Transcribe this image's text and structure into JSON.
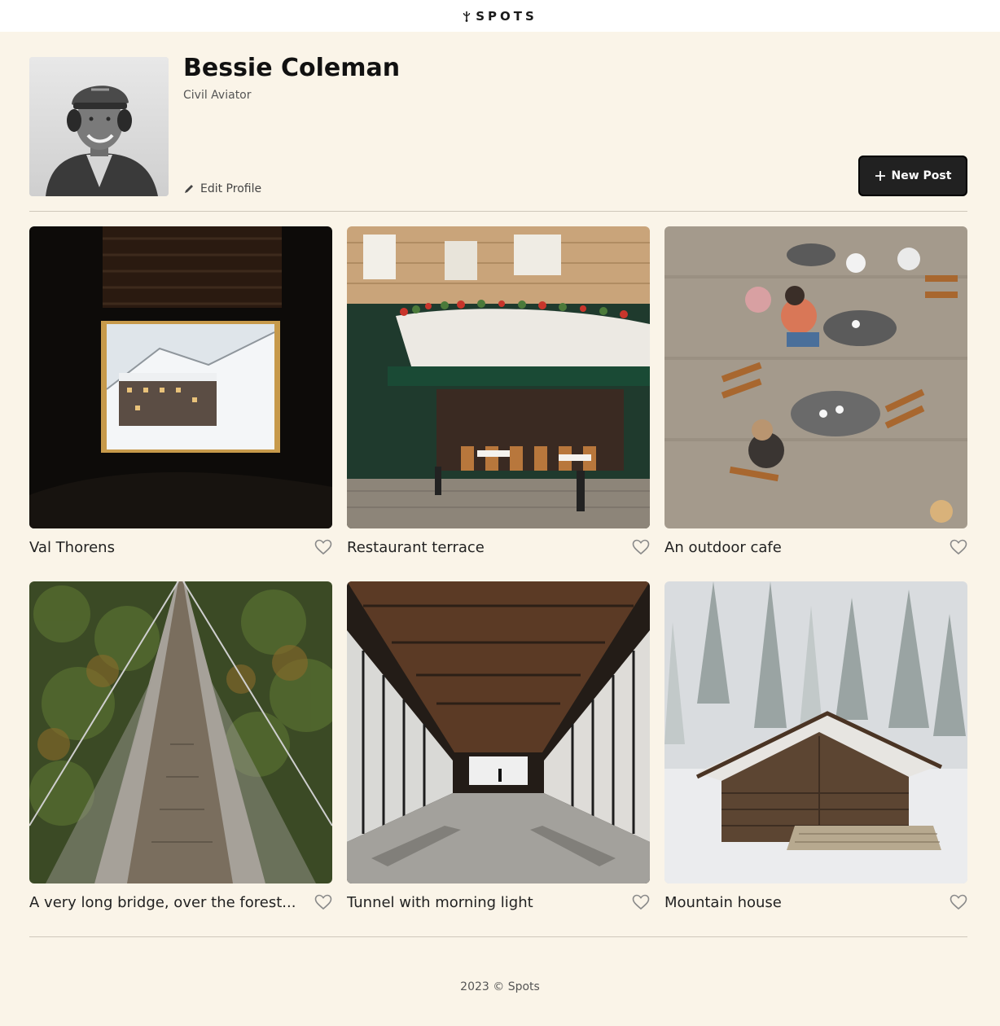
{
  "header": {
    "logo_text": "SPOTS",
    "logo_icon": "sprout-icon"
  },
  "profile": {
    "name": "Bessie Coleman",
    "description": "Civil Aviator",
    "edit_label": "Edit Profile",
    "new_post_label": "New Post"
  },
  "cards": [
    {
      "title": "Val Thorens"
    },
    {
      "title": "Restaurant terrace"
    },
    {
      "title": "An outdoor cafe"
    },
    {
      "title": "A very long bridge, over the forest..."
    },
    {
      "title": "Tunnel with morning light"
    },
    {
      "title": "Mountain house"
    }
  ],
  "footer": {
    "text": "2023 © Spots"
  }
}
